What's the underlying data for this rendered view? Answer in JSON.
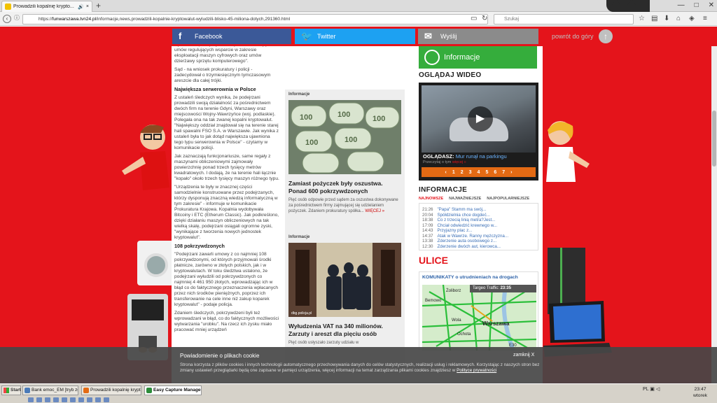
{
  "browser": {
    "tab_title": "Prowadzili kopalnię krypto...",
    "url_prefix": "https://",
    "url_host": "funwarszawa.tvn24.pl",
    "url_path": "/informacje,news,prowadzili-kopalnie-kryptowalut-wyludzili-blisko-45-miliona-dotych,291360.html",
    "search_placeholder": "Szukaj"
  },
  "share_bar": {
    "facebook": "Facebook",
    "twitter": "Twitter",
    "mail": "Wyślij",
    "back_to_top": "powrót do góry"
  },
  "article": {
    "lead": "wyłudzenia pieniędzy \"w związku z realizacją umów regulujących wsparcie w zakresie eksploatacji maszyn cyfrowych oraz umów dzierżawy sprzętu komputerowego\".",
    "p_court": "Sąd - na wniosek prokuratury i policji - zadecydował o trzymiesięcznym tymczasowym areszcie dla całej trójki.",
    "heading1": "Największa serwerownia w Polsce",
    "p1": "Z ustaleń śledczych wynika, że podejrzani prowadzili swoją działalność za pośrednictwem dwóch firm na terenie Gdyni, Warszawy oraz miejscowości Wojny-Wawrzyńce (woj. podlaskie). Polegała ona na tak zwanej kopalni kryptowalut. \"Największy oddział znajdował się na terenie starej hali spawalni FSO S.A. w Warszawie. Jak wynika z ustaleń była to jak dotąd największa ujawniona tego typu serwerownia w Polsce\" - czytamy w komunikacie policji.",
    "p2": "Jak zaznaczają funkcjonariusze, same regały z maszynami obliczeniowymi zajmowały powierzchnię ponad trzech tysięcy metrów kwadratowych. I dodają, że na terenie hali łącznie \"kopało\" około trzech tysięcy maszyn różnego typu.",
    "p3": "\"Urządzenia te były w znacznej części samodzielnie konstruowane przez podejrzanych, którzy dysponują znaczną wiedzą informatyczną w tym zakresie\" - informuje w komunikacie Prokuratura Krajowa. Kopalnia wydobywała Bitcoiny i ETC (Etherum Classic). Jak podkreślono, dzięki działaniu maszyn obliczeniowych na tak wielką skalę, podejrzani osiągali ogromne zyski, \"wynikające z tworzenia nowych jednostek kryptowalut\".",
    "heading2": "108 pokrzywdzonych",
    "p4": "\"Podejrzani zawarli umowy z co najmniej 108 pokrzywdzonymi, od których przyjmowali środki płatnicze, zarówno w złotych polskich, jak i w kryptowalutach. W toku śledztwa ustalono, że podejrzani wyłudzili od pokrzywdzonych co najmniej 4 461 950 złotych, wprowadzając ich w błąd co do faktycznego przeznaczenia wpłacanych przez nich środków pieniężnych, poprzez ich transferowanie na cele inne niż zakup koparek kryptowalut\" - podaje policja.",
    "p5": "Zdaniem śledczych, pokrzywdzeni byli też wprowadzani w błąd, co do faktycznych możliwości wytwarzania \"urobku\". Na rzecz ich zysku miało pracować mniej urządzeń"
  },
  "cards": [
    {
      "tag": "Informacje",
      "title": "Zamiast pożyczek były oszustwa. Ponad 600 pokrzywdzonych",
      "text": "Pięć osób odpowie przed sądem za oszustwa dokonywane za pośrednictwem firmy zajmującej się udzielaniem pożyczek. Zdaniem prokuratury spółka...",
      "more": "WIĘCEJ »"
    },
    {
      "tag": "Informacje",
      "title": "Wyłudzenia VAT na 340 milionów. Zarzuty i areszt dla pięciu osób",
      "text": "Pięć osób usłyszało zarzuty udziału w",
      "img_credit": "dbg.policja.pl"
    }
  ],
  "sidebar": {
    "info_button": "Informacje",
    "video_section": "OGLĄDAJ WIDEO",
    "video_caption_prefix": "OGLĄDASZ:",
    "video_caption_title": "Mur runął na parkingu",
    "video_sub": "Przeczytaj o tym",
    "video_sub_link": "więcej »",
    "video_pages": [
      "‹",
      "1",
      "2",
      "3",
      "4",
      "5",
      "6",
      "7",
      "›"
    ],
    "news_section": "INFORMACJE",
    "news_tabs": [
      "NAJNOWSZE",
      "NAJWAŻNIEJSZE",
      "NAJPOPULARNIEJSZE"
    ],
    "news": [
      {
        "time": "21:26",
        "title": "\"Papa\" Stamm ma swój..."
      },
      {
        "time": "20:04",
        "title": "Spółdzielnia chce dogdeć..."
      },
      {
        "time": "18:38",
        "title": "Co z trzecią linią metra?Jest..."
      },
      {
        "time": "17:09",
        "title": "Chciał odwiedzić krewnego w..."
      },
      {
        "time": "14:43",
        "title": "Przyjazny plac z..."
      },
      {
        "time": "14:37",
        "title": "Atak w Wawrze. Ranny mężczyzna..."
      },
      {
        "time": "13:38",
        "title": "Zderzenie auta osobowego z..."
      },
      {
        "time": "12:30",
        "title": "Zderzenie dwóch aut, kierowca..."
      }
    ],
    "streets_section": "ULICE",
    "traffic_title": "KOMUNIKATY o utrudnieniach na drogach",
    "traffic_bar_label": "Targeo Traffic:",
    "traffic_time": "23:35",
    "map_labels": [
      "Żoliborz",
      "Bemowo",
      "Wola",
      "Warszawa",
      "Ochota",
      "E30"
    ]
  },
  "cookie": {
    "title": "Powiadomienie o plikach cookie",
    "close": "zamknij X",
    "body": "Strona korzysta z plików cookies i innych technologii automatycznego przechowywania danych do celów statystycznych, realizacji usług i reklamowych. Korzystając z naszych stron bez zmiany ustawień przeglądarki będą one zapisane w pamięci urządzenia, więcej informacji na temat zarządzania plikami cookies znajdziesz w",
    "link": "Polityce prywatności"
  },
  "taskbar": {
    "start": "Start",
    "tasks": [
      "Bank emoc_EM [tryb zgo...",
      "Prowadzili kopalnię krypt...",
      "Easy Capture Manager"
    ],
    "lang": "PL",
    "time": "23:47",
    "day": "wtorek"
  },
  "colors": {
    "page_red": "#e4141b",
    "facebook": "#3b5998",
    "twitter": "#1da1f2",
    "info_green": "#35ad3c",
    "video_orange": "#e36a14"
  }
}
